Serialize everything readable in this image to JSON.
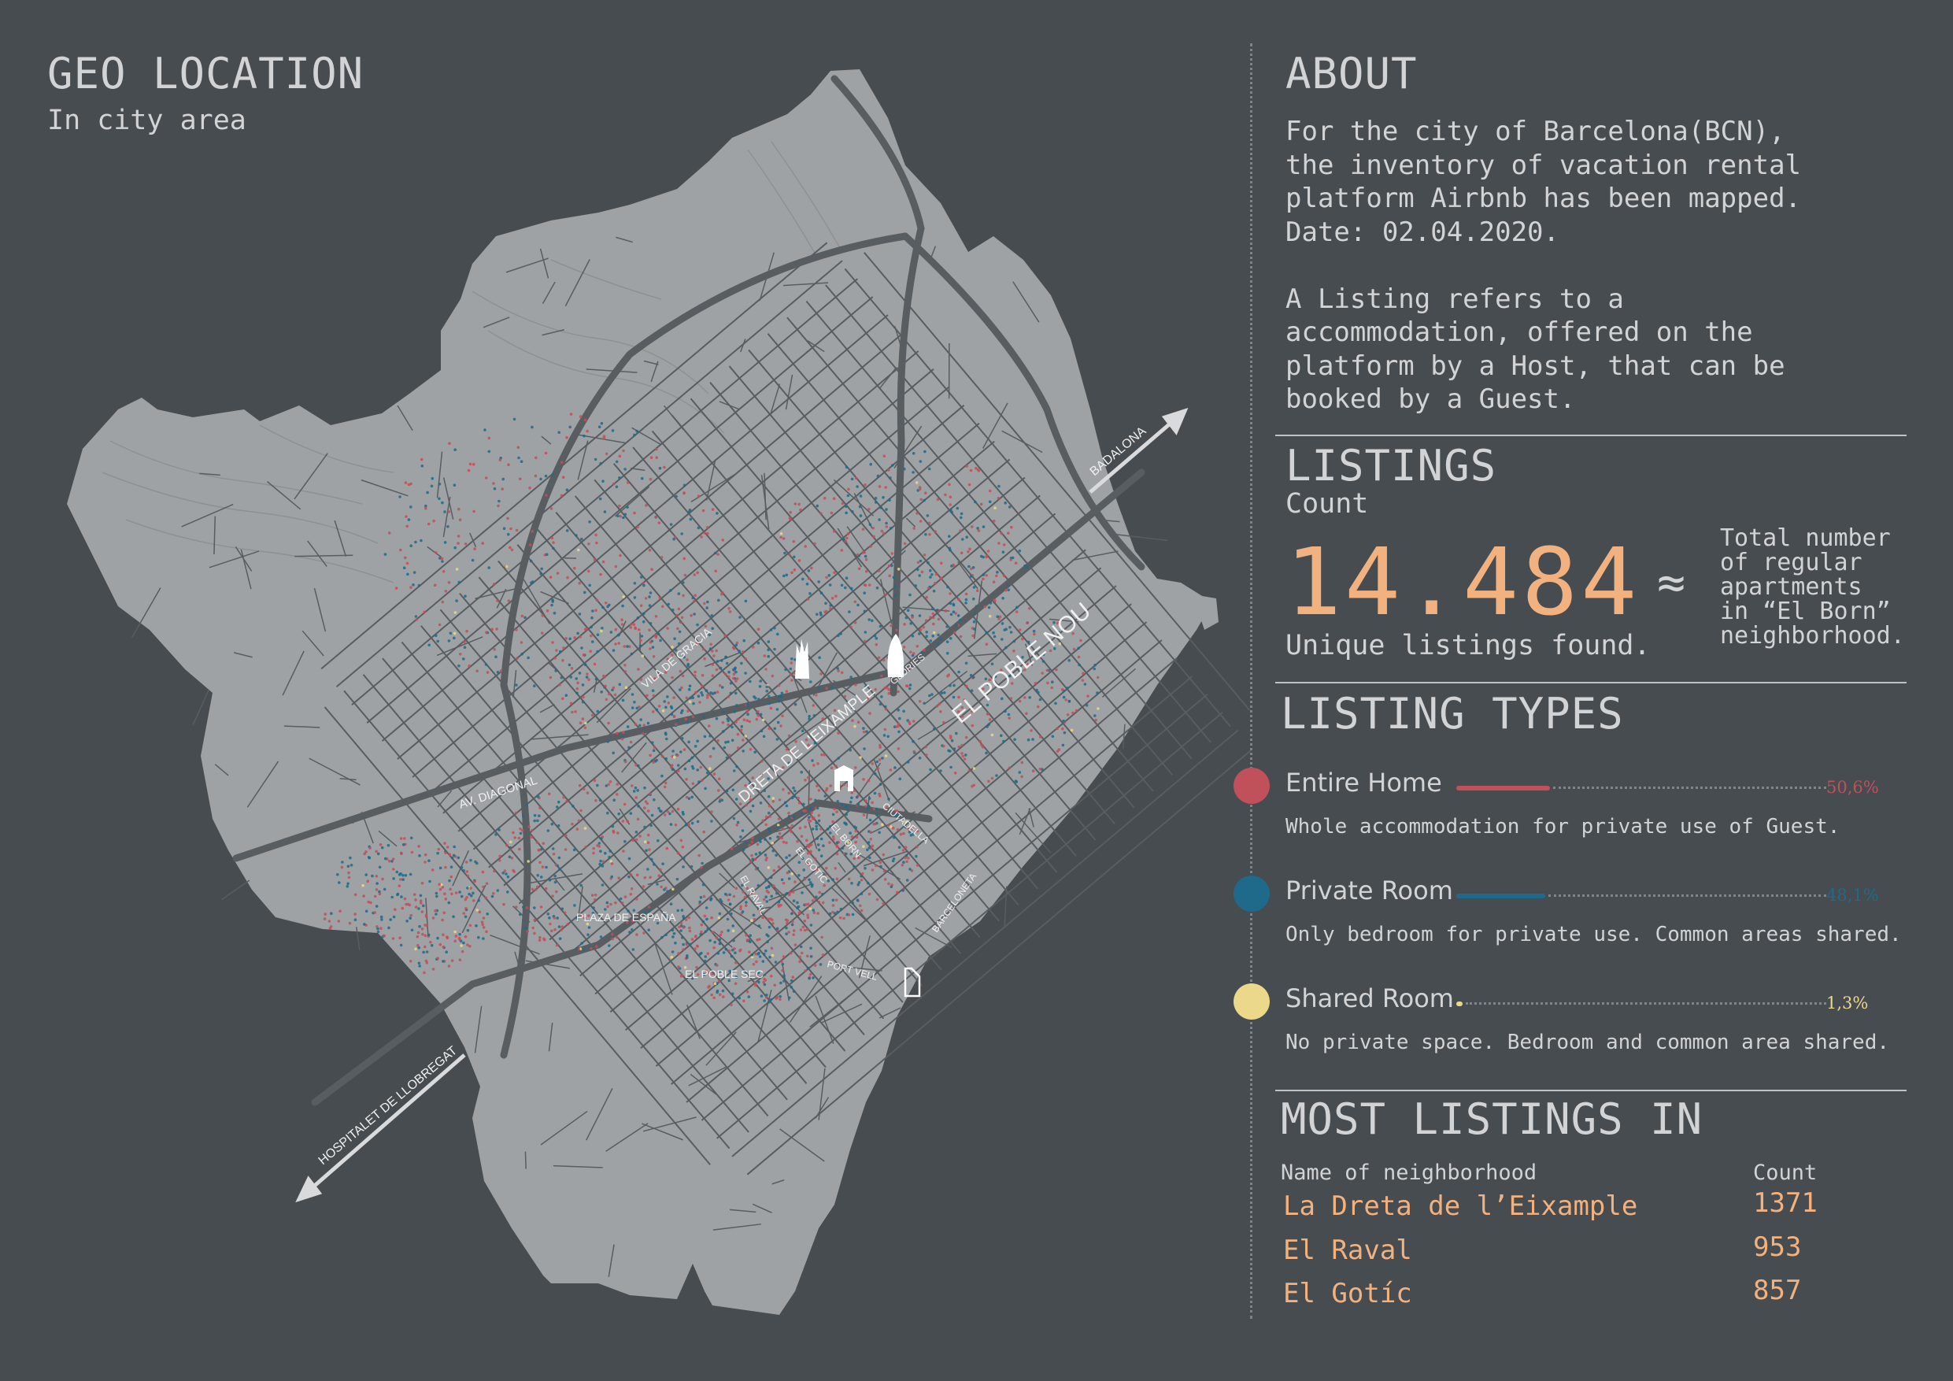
{
  "geo": {
    "title": "GEO LOCATION",
    "subtitle": "In city area"
  },
  "map": {
    "labels": {
      "badalona": "BADALONA",
      "hospitalet": "HOSPITALET DE LLOBREGAT",
      "poblenou": "EL POBLE NOU",
      "dreta": "DRETA DE L'EIXAMPLE",
      "gracia": "VILA DE GRACIA",
      "diagonal": "AV. DIAGONAL",
      "espana": "PLAZA DE ESPAÑA",
      "poblesec": "EL POBLE SEC",
      "portvell": "PORT VELL",
      "barceloneta": "BARCELONETA",
      "ciutadella": "CIUTADELLA",
      "raval": "EL RAVAL",
      "gotic": "EL GOTIC",
      "born": "EL BORN",
      "glories": "GLORIES"
    },
    "colors": {
      "land": "#9fa2a4",
      "roads": "#585d61",
      "entire": "#c0505a",
      "private": "#1f6a8a",
      "shared": "#ebd88a"
    }
  },
  "about": {
    "title": "ABOUT",
    "lines": [
      "For the city of Barcelona(BCN),",
      "the inventory of vacation rental",
      "platform Airbnb has been mapped.",
      "Date: 02.04.2020.",
      "",
      "A Listing refers to a",
      "accommodation, offered on the",
      "platform by a Host, that can be",
      "booked by a Guest."
    ]
  },
  "listings": {
    "title": "LISTINGS",
    "subtitle": "Count",
    "count": "14.484",
    "count_caption": "Unique listings found.",
    "approx": "≈",
    "note_lines": [
      "Total number",
      "of regular",
      "apartments",
      "in “El Born”",
      "neighborhood."
    ]
  },
  "types": {
    "title": "LISTING TYPES",
    "items": [
      {
        "label": "Entire Home",
        "desc": "Whole accommodation for private use of Guest.",
        "pct_label": "50,6%",
        "pct": 50.6,
        "color": "#c0505a"
      },
      {
        "label": "Private Room",
        "desc": "Only bedroom for private use. Common areas shared.",
        "pct_label": "48,1%",
        "pct": 48.1,
        "color": "#1f6a8a"
      },
      {
        "label": "Shared Room",
        "desc": "No private space. Bedroom and common area shared.",
        "pct_label": "1,3%",
        "pct": 1.3,
        "color": "#ebd88a"
      }
    ]
  },
  "most": {
    "title": "MOST LISTINGS IN",
    "col_name": "Name of neighborhood",
    "col_count": "Count",
    "rows": [
      {
        "name": "La Dreta de l’Eixample",
        "count": "1371"
      },
      {
        "name": "El Raval",
        "count": "953"
      },
      {
        "name": "El Gotíc",
        "count": "857"
      }
    ]
  }
}
